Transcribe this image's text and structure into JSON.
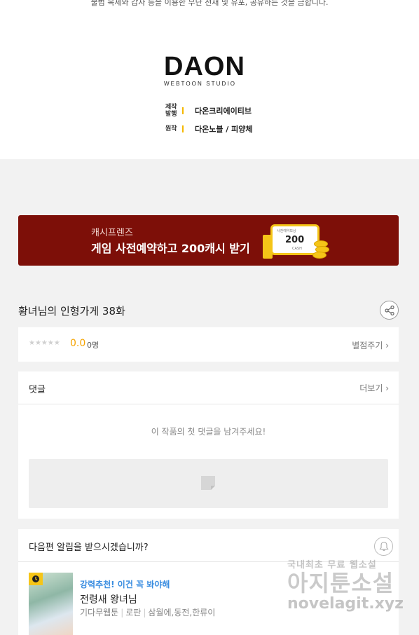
{
  "header": {
    "top_note": "불법 복제와 갑자 등을 이용한 무단 전재 및 유포, 공유하는 것을 금합니다.",
    "logo_text": "DAON",
    "logo_subtext": "WEBTOON STUDIO",
    "credits": [
      {
        "key": "제작 발행",
        "value": "다온크리에이티브"
      },
      {
        "key": "원작",
        "value": "다온노블 / 피양체"
      }
    ]
  },
  "banner": {
    "subtitle": "캐시프렌즈",
    "title": "게임 사전예약하고 200캐시 받기",
    "card_small_top": "사전예약보상",
    "card_value": "200",
    "card_small_bottom": "CASH",
    "background_color": "#7d0f08",
    "accent_color": "#f5c518"
  },
  "episode": {
    "title": "황녀님의 인형가게 38화",
    "share_icon": "share-icon"
  },
  "rating": {
    "stars": "★★★★★",
    "score": "0.0",
    "count": "0명",
    "rate_link": "별점주기 ›"
  },
  "comments": {
    "title": "댓글",
    "more_link": "더보기 ›",
    "empty_message": "이 작품의 첫 댓글을 남겨주세요!"
  },
  "notify": {
    "title": "다음편 알림을 받으시겠습니까?",
    "bell_icon": "bell-icon"
  },
  "recommendation": {
    "promo": "강력추천! 이건 꼭 봐야해",
    "title": "전령새 왕녀님",
    "meta": [
      "기다무웹툰",
      "로판",
      "삼월에,동전,한류이"
    ]
  },
  "watermark": {
    "line1": "국내최초 무료 웹소설",
    "line2": "아지툰소설",
    "line3": "novelagit.xyz"
  }
}
